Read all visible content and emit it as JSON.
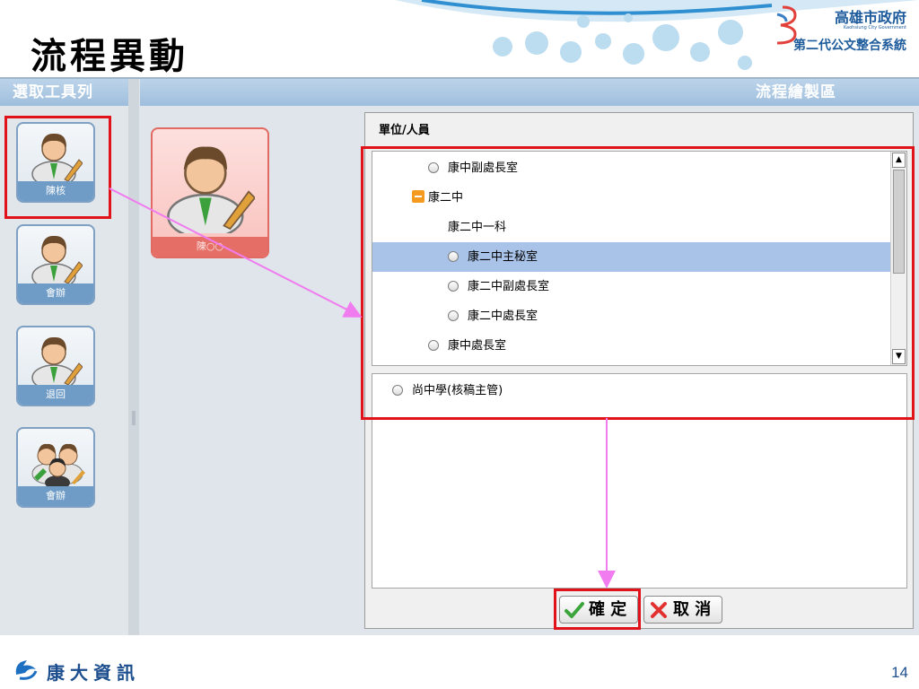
{
  "slide": {
    "title": "流程異動",
    "page_number": "14"
  },
  "branding": {
    "gov_name": "高雄市政府",
    "gov_sub": "Kaohsiung City Government",
    "gov_system": "第二代公文整合系統",
    "footer_company": "康大資訊"
  },
  "app": {
    "left_header": "選取工具列",
    "right_header": "流程繪製區",
    "tools": [
      {
        "label": "陳核",
        "icon": "user-edit-icon"
      },
      {
        "label": "會辦",
        "icon": "user-edit-icon"
      },
      {
        "label": "退回",
        "icon": "user-edit-icon"
      },
      {
        "label": "會辦",
        "icon": "group-icon"
      }
    ],
    "flow_node": {
      "label": "陳○○",
      "icon": "user-edit-icon"
    }
  },
  "dialog": {
    "title": "單位/人員",
    "tree": [
      {
        "label": "康中副處長室",
        "type": "radio",
        "selected": false
      },
      {
        "label": "康二中",
        "type": "folder-expanded",
        "selected": false
      },
      {
        "label": "康二中一科",
        "type": "group",
        "selected": false
      },
      {
        "label": "康二中主秘室",
        "type": "radio",
        "selected": true
      },
      {
        "label": "康二中副處長室",
        "type": "radio",
        "selected": false
      },
      {
        "label": "康二中處長室",
        "type": "radio",
        "selected": false
      },
      {
        "label": "康中處長室",
        "type": "radio",
        "selected": false
      }
    ],
    "selected_list": [
      {
        "label": "尚中學(核稿主管)"
      }
    ],
    "ok_label": "確 定",
    "cancel_label": "取 消"
  },
  "colors": {
    "highlight": "#e0131b",
    "arrow": "#f07cf0",
    "header_blue": "#9fbedd",
    "row_selected": "#a9c3e8",
    "node_red": "#e56f66"
  }
}
